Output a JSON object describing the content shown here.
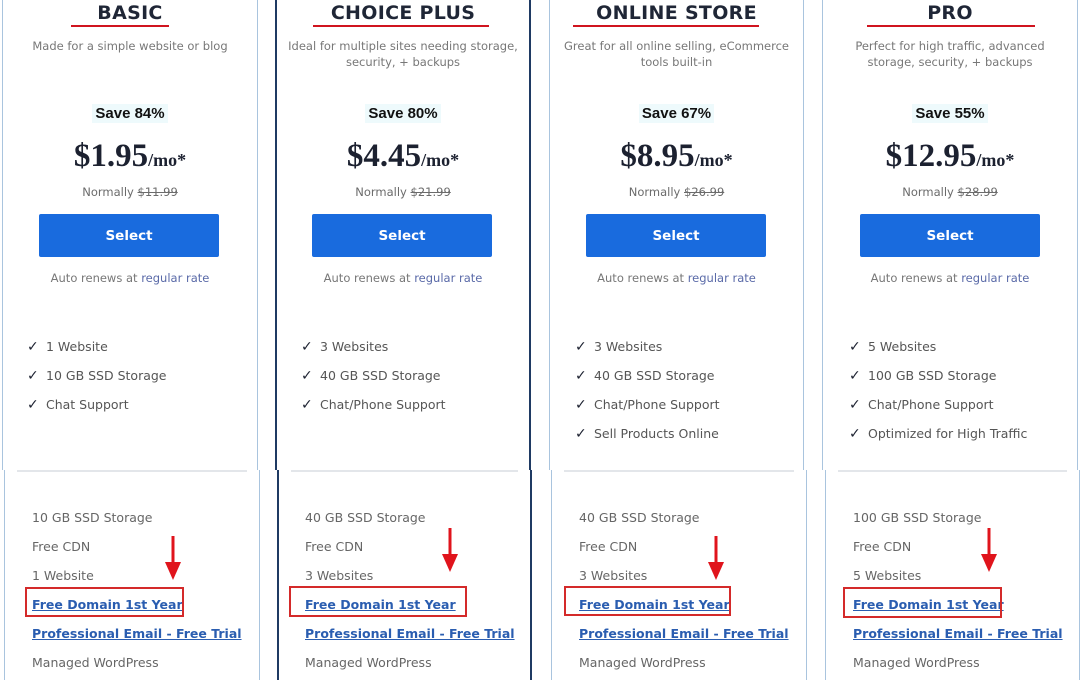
{
  "plans": [
    {
      "name": "BASIC",
      "description": "Made for a simple website or blog",
      "savings": "Save 84%",
      "price": "$1.95",
      "price_unit": "/mo*",
      "normally_label": "Normally",
      "normal_price": "$11.99",
      "select_label": "Select",
      "renew_text": "Auto renews at",
      "renew_link": "regular rate",
      "features": [
        "1 Website",
        "10 GB SSD Storage",
        "Chat Support"
      ],
      "details": [
        "10 GB SSD Storage",
        "Free CDN",
        "1 Website",
        "Free Domain 1st Year",
        "Professional Email - Free Trial",
        "Managed WordPress"
      ]
    },
    {
      "name": "CHOICE PLUS",
      "description": "Ideal for multiple sites needing storage, security, + backups",
      "savings": "Save 80%",
      "price": "$4.45",
      "price_unit": "/mo*",
      "normally_label": "Normally",
      "normal_price": "$21.99",
      "select_label": "Select",
      "renew_text": "Auto renews at",
      "renew_link": "regular rate",
      "features": [
        "3 Websites",
        "40 GB SSD Storage",
        "Chat/Phone Support"
      ],
      "details": [
        "40 GB SSD Storage",
        "Free CDN",
        "3 Websites",
        "Free Domain 1st Year",
        "Professional Email - Free Trial",
        "Managed WordPress"
      ]
    },
    {
      "name": "ONLINE STORE",
      "description": "Great for all online selling, eCommerce tools built-in",
      "savings": "Save 67%",
      "price": "$8.95",
      "price_unit": "/mo*",
      "normally_label": "Normally",
      "normal_price": "$26.99",
      "select_label": "Select",
      "renew_text": "Auto renews at",
      "renew_link": "regular rate",
      "features": [
        "3 Websites",
        "40 GB SSD Storage",
        "Chat/Phone Support",
        "Sell Products Online"
      ],
      "details": [
        "40 GB SSD Storage",
        "Free CDN",
        "3 Websites",
        "Free Domain 1st Year",
        "Professional Email - Free Trial",
        "Managed WordPress"
      ]
    },
    {
      "name": "PRO",
      "description": "Perfect for high traffic, advanced storage, security, + backups",
      "savings": "Save 55%",
      "price": "$12.95",
      "price_unit": "/mo*",
      "normally_label": "Normally",
      "normal_price": "$28.99",
      "select_label": "Select",
      "renew_text": "Auto renews at",
      "renew_link": "regular rate",
      "features": [
        "5 Websites",
        "100 GB SSD Storage",
        "Chat/Phone Support",
        "Optimized for High Traffic"
      ],
      "details": [
        "100 GB SSD Storage",
        "Free CDN",
        "5 Websites",
        "Free Domain 1st Year",
        "Professional Email - Free Trial",
        "Managed WordPress"
      ]
    }
  ],
  "icons": {
    "feature_check": "checkmark-icon",
    "annotation": "red-down-arrow-icon"
  },
  "colors": {
    "select_button": "#196bde",
    "annotation_red": "#d42a2a",
    "link_blue": "#2a5db0",
    "featured_border": "#1f3a63"
  }
}
